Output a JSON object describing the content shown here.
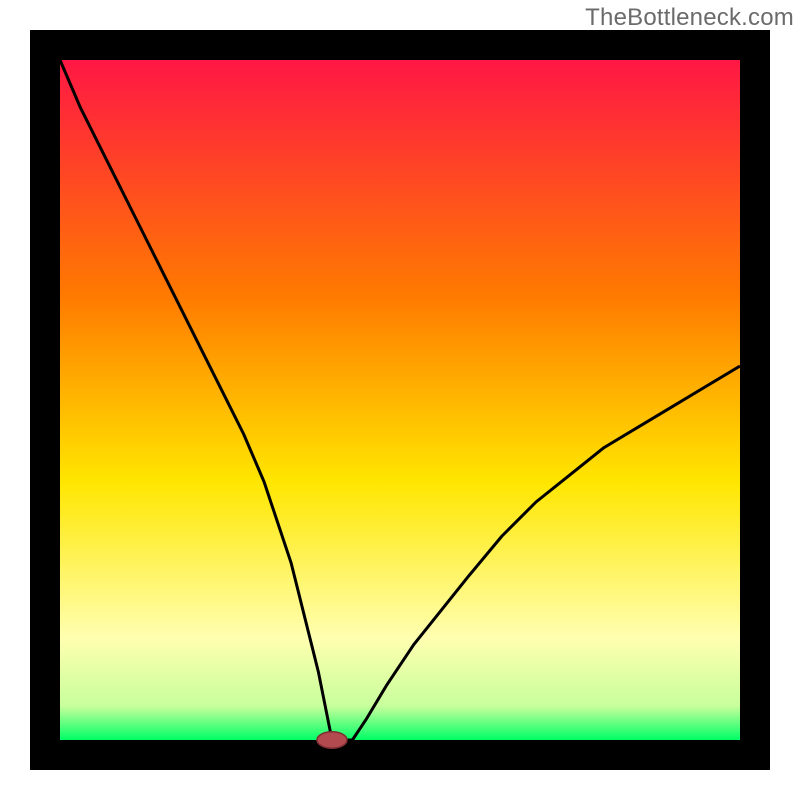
{
  "watermark": "TheBottleneck.com",
  "colors": {
    "black": "#000000",
    "grad_top": "#ff1744",
    "grad_mid1": "#ff7b00",
    "grad_mid2": "#ffe600",
    "grad_light": "#ffffb0",
    "grad_bottom": "#00ff66",
    "marker_fill": "#b24a50",
    "marker_stroke": "#7e2e33"
  },
  "chart_data": {
    "type": "line",
    "title": "",
    "xlabel": "",
    "ylabel": "",
    "xlim": [
      0,
      100
    ],
    "ylim": [
      0,
      100
    ],
    "series": [
      {
        "name": "curve",
        "x": [
          0,
          3,
          6,
          9,
          12,
          15,
          18,
          21,
          24,
          27,
          30,
          32,
          34,
          35,
          36,
          37,
          38,
          39,
          40,
          41,
          43,
          45,
          48,
          52,
          56,
          60,
          65,
          70,
          75,
          80,
          85,
          90,
          95,
          100
        ],
        "y": [
          100,
          93,
          87,
          81,
          75,
          69,
          63,
          57,
          51,
          45,
          38,
          32,
          26,
          22,
          18,
          14,
          10,
          5,
          0,
          0,
          0,
          3,
          8,
          14,
          19,
          24,
          30,
          35,
          39,
          43,
          46,
          49,
          52,
          55
        ]
      }
    ],
    "marker": {
      "x": 40,
      "y": 0,
      "rx": 2.2,
      "ry": 1.2
    }
  }
}
